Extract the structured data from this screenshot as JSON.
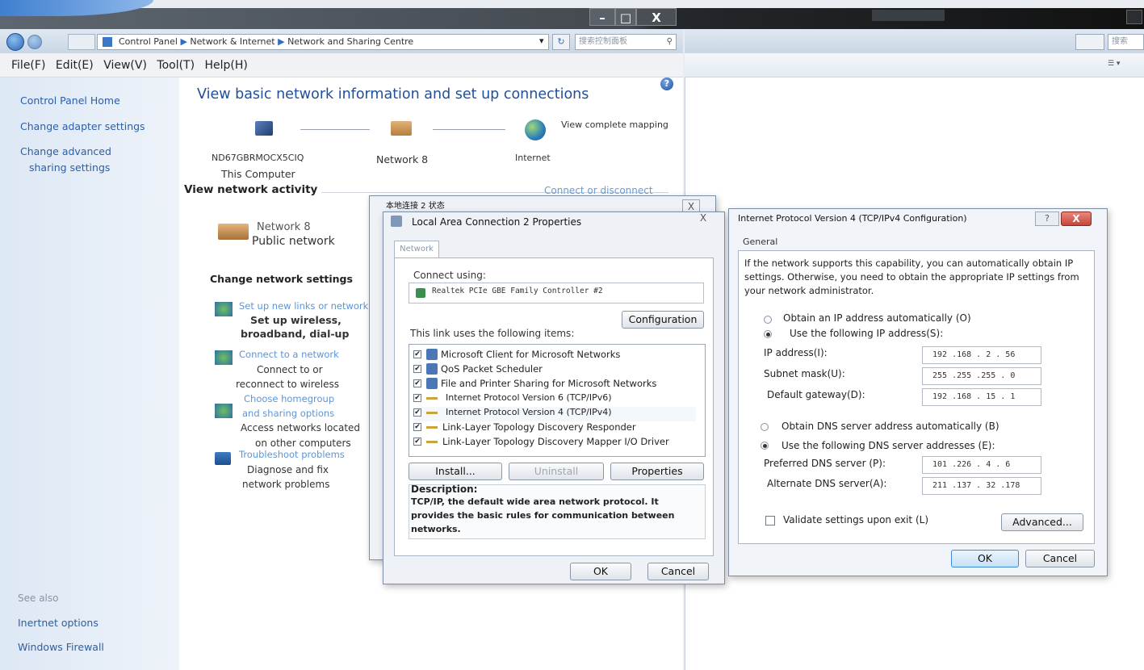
{
  "window": {
    "minimize": "–",
    "maximize": "□",
    "close": "X"
  },
  "address": {
    "breadcrumb": [
      "Control Panel",
      "Network & Internet",
      "Network and Sharing Centre"
    ],
    "dropdown": "▾",
    "refresh": "↻",
    "search_placeholder": "搜索控制面板",
    "second_search_placeholder": "搜索"
  },
  "menu": [
    "File(F)",
    "Edit(E)",
    "View(V)",
    "Tool(T)",
    "Help(H)"
  ],
  "sidebar": {
    "items": [
      "Control Panel Home",
      "Change adapter settings",
      "Change advanced",
      "sharing settings"
    ],
    "see_also": "See also",
    "see_also_items": [
      "Inertnet options",
      "Windows Firewall"
    ]
  },
  "main": {
    "title": "View basic network information and set up connections",
    "help": "?",
    "map": {
      "computer_name": "ND67GBRMOCX5CIQ",
      "computer_label": "This Computer",
      "network": "Network 8",
      "internet": "Internet",
      "view_mapping": "View complete mapping"
    },
    "activity_heading": "View network activity",
    "connect_link": "Connect or disconnect",
    "network_name": "Network 8",
    "network_type": "Public network",
    "change_heading": "Change network settings",
    "tasks": [
      {
        "link": "Set up new links or networks",
        "desc": [
          "Set up wireless,",
          "broadband, dial-up"
        ]
      },
      {
        "link": "Connect to a network",
        "desc": [
          "Connect to or",
          "reconnect to wireless"
        ]
      },
      {
        "link": "Choose homegroup",
        "link2": "and sharing options",
        "desc": [
          "Access networks located",
          "on other computers"
        ]
      },
      {
        "link": "Troubleshoot problems",
        "desc": [
          "Diagnose and fix",
          "network problems"
        ]
      }
    ]
  },
  "status_dialog": {
    "title": "本地连接 2 状态",
    "close": "X"
  },
  "props_dialog": {
    "title": "Local Area Connection 2 Properties",
    "close": "X",
    "tab": "Network",
    "connect_using": "Connect using:",
    "adapter": "Realtek PCIe GBE Family Controller #2",
    "configuration": "Configuration",
    "items_label": "This link uses the following items:",
    "items": [
      "Microsoft Client for Microsoft Networks",
      "QoS Packet Scheduler",
      "File and Printer Sharing for Microsoft Networks",
      "Internet Protocol Version 6 (TCP/IPv6)",
      "Internet Protocol Version 4 (TCP/IPv4)",
      "Link-Layer Topology Discovery Responder",
      "Link-Layer Topology Discovery Mapper I/O Driver"
    ],
    "check": "✔",
    "install": "Install...",
    "uninstall": "Uninstall",
    "properties": "Properties",
    "description_label": "Description:",
    "description": "TCP/IP, the default wide area network protocol. It provides the basic rules for communication between networks.",
    "ok": "OK",
    "cancel": "Cancel"
  },
  "ipv4_dialog": {
    "title": "Internet Protocol Version 4 (TCP/IPv4 Configuration)",
    "help": "?",
    "close": "X",
    "tab": "General",
    "info": "If the network supports this capability, you can automatically obtain IP settings. Otherwise, you need to obtain the appropriate IP settings from your network administrator.",
    "obtain_ip": "Obtain an IP address automatically (O)",
    "use_ip": "Use the following IP address(S):",
    "ip_label": "IP address(I):",
    "ip": "192 .168 . 2 . 56",
    "subnet_label": "Subnet mask(U):",
    "subnet": "255 .255 .255 . 0",
    "gateway_label": "Default gateway(D):",
    "gateway": "192 .168 . 15 . 1",
    "obtain_dns": "Obtain DNS server address automatically (B)",
    "use_dns": "Use the following DNS server addresses (E):",
    "preferred_label": "Preferred DNS server (P):",
    "preferred": "101 .226 . 4 . 6",
    "alternate_label": "Alternate DNS server(A):",
    "alternate": "211 .137 . 32 .178",
    "validate": "Validate settings upon exit (L)",
    "advanced": "Advanced...",
    "ok": "OK",
    "cancel": "Cancel"
  }
}
